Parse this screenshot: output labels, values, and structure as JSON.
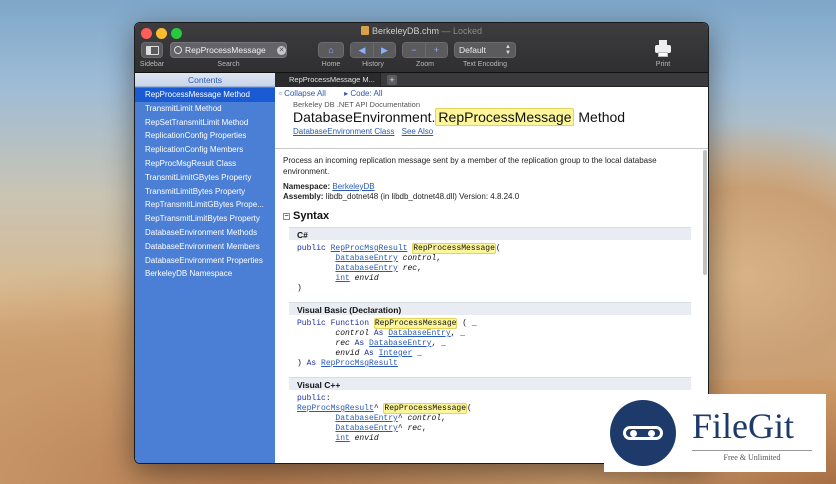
{
  "window": {
    "title": "BerkeleyDB.chm",
    "title_suffix": " — Locked"
  },
  "toolbar": {
    "sidebar_label": "Sidebar",
    "search_label": "Search",
    "search_value": "RepProcessMessage",
    "home_label": "Home",
    "history_label": "History",
    "zoom_label": "Zoom",
    "encoding_label": "Text Encoding",
    "encoding_value": "Default",
    "print_label": "Print"
  },
  "sidebar": {
    "header": "Contents",
    "items": [
      "RepProcessMessage Method",
      "TransmitLimit Method",
      "RepSetTransmitLimit Method",
      "ReplicationConfig Properties",
      "ReplicationConfig Members",
      "RepProcMsgResult Class",
      "TransmitLimitGBytes Property",
      "TransmitLimitBytes Property",
      "RepTransmitLimitGBytes Prope...",
      "RepTransmitLimitBytes Property",
      "DatabaseEnvironment Methods",
      "DatabaseEnvironment Members",
      "DatabaseEnvironment Properties",
      "BerkeleyDB Namespace"
    ]
  },
  "tabs": {
    "active": "RepProcessMessage M...",
    "add": "+"
  },
  "doc": {
    "collapse_all": "Collapse All",
    "code_all": "Code: All",
    "library": "Berkeley DB .NET API Documentation",
    "title_prefix": "DatabaseEnvironment.",
    "title_highlight": "RepProcessMessage",
    "title_suffix": "Method",
    "link_class": "DatabaseEnvironment Class",
    "link_see_also": "See Also",
    "description": "Process an incoming replication message sent by a member of the replication group to the local database environment.",
    "namespace_label": "Namespace:",
    "namespace_value": "BerkeleyDB",
    "assembly_label": "Assembly:",
    "assembly_value": "libdb_dotnet48 (in libdb_dotnet48.dll) Version: 4.8.24.0",
    "syntax_title": "Syntax",
    "code": {
      "csharp_title": "C#",
      "vb_title": "Visual Basic (Declaration)",
      "cpp_title": "Visual C++"
    }
  },
  "watermark": {
    "name": "FileGit",
    "tagline": "Free & Unlimited"
  }
}
